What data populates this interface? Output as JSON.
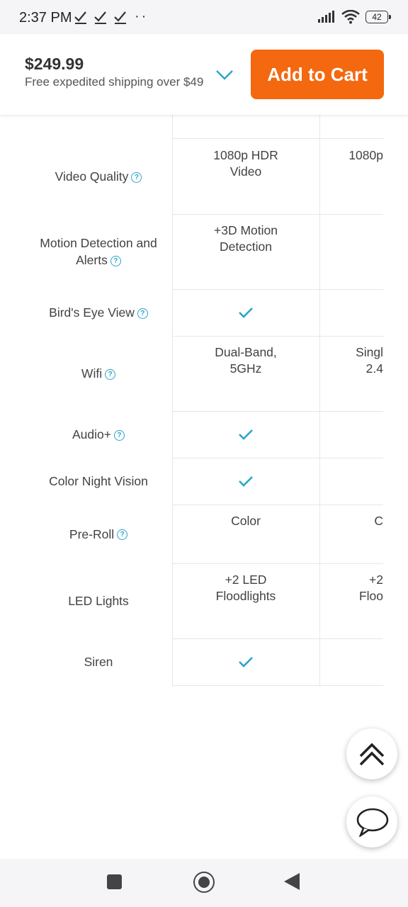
{
  "status": {
    "time": "2:37 PM",
    "battery": "42"
  },
  "cartbar": {
    "price": "$249.99",
    "shipping": "Free expedited shipping over $49",
    "add_to_cart": "Add to Cart"
  },
  "table": {
    "rows": [
      {
        "label": "Video Quality",
        "help": true,
        "col1": [
          "1080p HDR",
          "Video"
        ],
        "col2": [
          "1080p"
        ]
      },
      {
        "label": "Motion Detection and Alerts",
        "help": true,
        "col1": [
          "+3D Motion",
          "Detection"
        ],
        "col2": []
      },
      {
        "label": "Bird's Eye View",
        "help": true,
        "col1_check": true,
        "col2": []
      },
      {
        "label": "Wifi",
        "help": true,
        "col1": [
          "Dual-Band,",
          "5GHz"
        ],
        "col2": [
          "Singl",
          "2.4"
        ]
      },
      {
        "label": "Audio+",
        "help": true,
        "col1_check": true,
        "col2": []
      },
      {
        "label": "Color Night Vision",
        "help": false,
        "col1_check": true,
        "col2": []
      },
      {
        "label": "Pre-Roll",
        "help": true,
        "col1": [
          "Color"
        ],
        "col2": [
          "C"
        ]
      },
      {
        "label": "LED Lights",
        "help": false,
        "col1": [
          "+2 LED",
          "Floodlights"
        ],
        "col2": [
          "+2",
          "Floo"
        ]
      },
      {
        "label": "Siren",
        "help": false,
        "col1_check": true,
        "col2": []
      }
    ]
  },
  "icons": {
    "help": "question-icon",
    "check": "checkmark-icon",
    "scroll_top": "double-chevron-up-icon",
    "chat": "chat-bubble-icon"
  },
  "colors": {
    "accent": "#f4680f",
    "check": "#2aa5c9"
  }
}
